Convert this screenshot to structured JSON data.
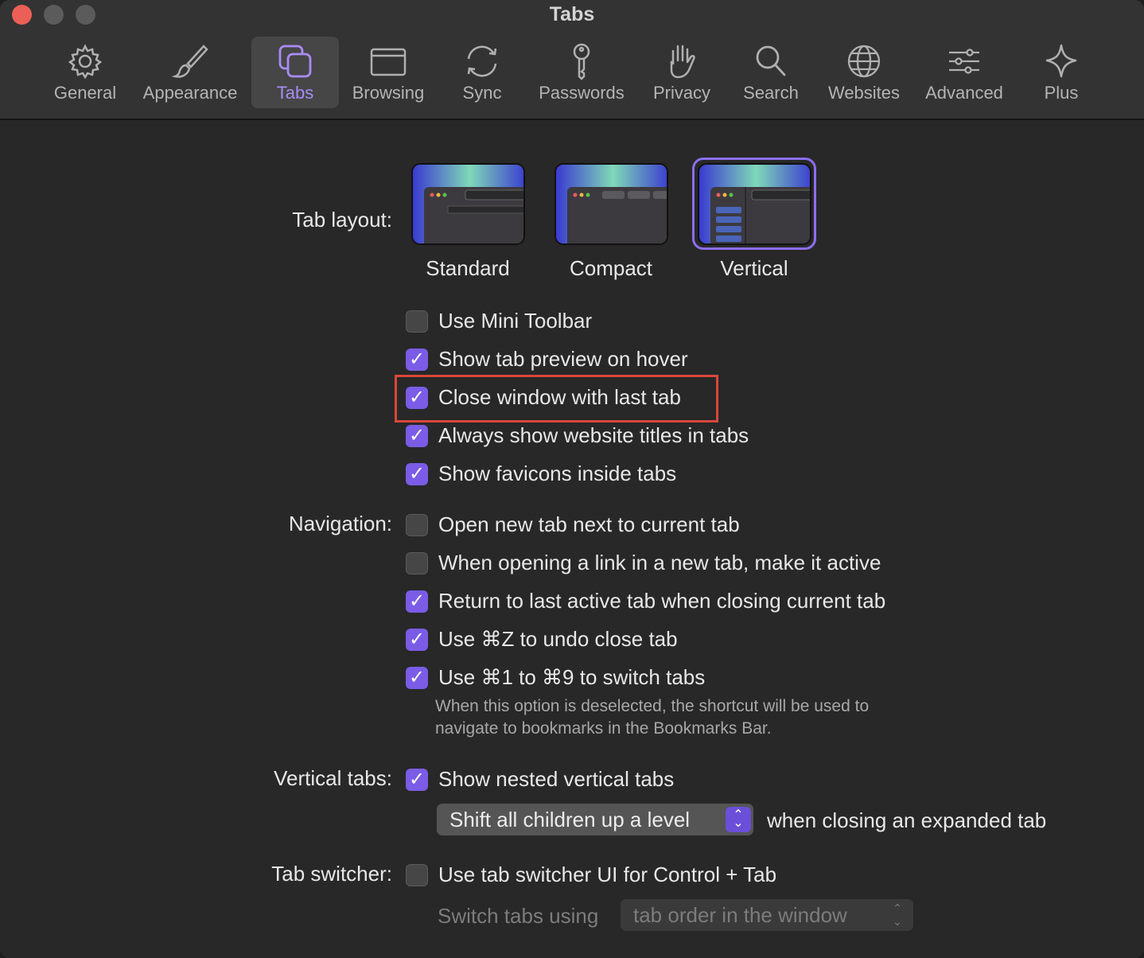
{
  "window": {
    "title": "Tabs"
  },
  "toolbar": {
    "items": [
      {
        "label": "General",
        "icon": "gear-icon"
      },
      {
        "label": "Appearance",
        "icon": "brush-icon"
      },
      {
        "label": "Tabs",
        "icon": "tabs-icon",
        "selected": true
      },
      {
        "label": "Browsing",
        "icon": "browser-window-icon"
      },
      {
        "label": "Sync",
        "icon": "sync-icon"
      },
      {
        "label": "Passwords",
        "icon": "key-icon"
      },
      {
        "label": "Privacy",
        "icon": "hand-icon"
      },
      {
        "label": "Search",
        "icon": "magnifier-icon"
      },
      {
        "label": "Websites",
        "icon": "globe-icon"
      },
      {
        "label": "Advanced",
        "icon": "sliders-icon"
      },
      {
        "label": "Plus",
        "icon": "sparkle-icon"
      }
    ]
  },
  "tab_layout": {
    "label": "Tab layout:",
    "options": [
      {
        "label": "Standard",
        "selected": false
      },
      {
        "label": "Compact",
        "selected": false
      },
      {
        "label": "Vertical",
        "selected": true
      }
    ]
  },
  "layout_checkboxes": [
    {
      "label": "Use Mini Toolbar",
      "checked": false
    },
    {
      "label": "Show tab preview on hover",
      "checked": true
    },
    {
      "label": "Close window with last tab",
      "checked": true,
      "highlighted": true
    },
    {
      "label": "Always show website titles in tabs",
      "checked": true
    },
    {
      "label": "Show favicons inside tabs",
      "checked": true
    }
  ],
  "navigation": {
    "label": "Navigation:",
    "checkboxes": [
      {
        "label": "Open new tab next to current tab",
        "checked": false
      },
      {
        "label": "When opening a link in a new tab, make it active",
        "checked": false
      },
      {
        "label": "Return to last active tab when closing current tab",
        "checked": true
      },
      {
        "label": "Use ⌘Z to undo close tab",
        "checked": true
      },
      {
        "label": "Use ⌘1 to ⌘9 to switch tabs",
        "checked": true
      }
    ],
    "hint_line1": "When this option is deselected, the shortcut will be used to",
    "hint_line2": "navigate to bookmarks in the Bookmarks Bar."
  },
  "vertical_tabs": {
    "label": "Vertical tabs:",
    "checkbox": {
      "label": "Show nested vertical tabs",
      "checked": true
    },
    "select_value": "Shift all children up a level",
    "select_suffix": "when closing an expanded tab"
  },
  "tab_switcher": {
    "label": "Tab switcher:",
    "checkbox": {
      "label": "Use tab switcher UI for Control + Tab",
      "checked": false
    },
    "switch_label": "Switch tabs using",
    "select_value": "tab order in the window"
  },
  "colors": {
    "accent": "#7a5ce6",
    "highlight_box": "#d9473a",
    "background": "#282828"
  }
}
